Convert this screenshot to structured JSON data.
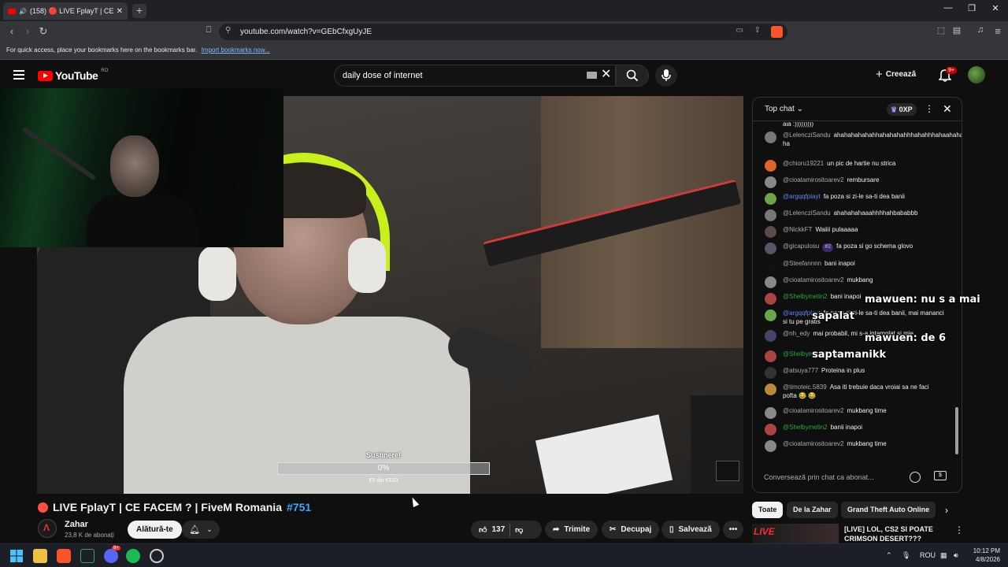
{
  "browser": {
    "tab_title": "(158) 🔴 LIVE FplayT | CE FAC",
    "tab_count_badge": "(158)",
    "url": "youtube.com/watch?v=GEbCfxgUyJE",
    "bookmarks_prompt": "For quick access, place your bookmarks here on the bookmarks bar.",
    "bookmarks_link": "Import bookmarks now..."
  },
  "youtube": {
    "logo_text": "YouTube",
    "country_code": "RO",
    "search_value": "daily dose of internet",
    "create_label": "Creează",
    "notifications_count": "9+"
  },
  "video": {
    "goal_label": "Sustinere!",
    "goal_percent": "0%",
    "goal_amount": "€0 din €100",
    "goal_progress": 0,
    "title_prefix": "LIVE FplayT | CE FACEM ? | FiveM Romania",
    "title_hashtag": "#751",
    "channel_name": "Zahar",
    "subscribers": "23,8 K de abonați",
    "join_label": "Alătură-te",
    "likes": "137",
    "share_label": "Trimite",
    "clip_label": "Decupaj",
    "save_label": "Salvează"
  },
  "chat": {
    "header": "Top chat",
    "xp": "0XP",
    "input_placeholder": "Conversează prin chat ca abonat...",
    "messages": [
      {
        "author": "",
        "text": "aia :)))))))))",
        "color": "#555"
      },
      {
        "author": "@LelencziSandu",
        "text": "ahahahahahahhahahahahhhahahhhahaahahahaha ha",
        "color": "#777"
      },
      {
        "author": "@chioru19221",
        "text": "un pic de hartie nu strica",
        "color": "#e0632c"
      },
      {
        "author": "@cioatamirositoarev2",
        "text": "rembursare",
        "color": "#888"
      },
      {
        "author": "@argqqfplayt",
        "text": "fa poza si zi-le sa-ti dea banii",
        "color": "#6aa54a"
      },
      {
        "author": "@LelencziSandu",
        "text": "ahahahahaaahhhhahbababbb",
        "color": "#777"
      },
      {
        "author": "@NickkFT",
        "text": "Waiiii pulaaaaa",
        "color": "#5a4a4a"
      },
      {
        "author": "@gicapulosu",
        "text": "fa poza si go schema glovo",
        "color": "#556"
      },
      {
        "author": "@Steefannnn",
        "text": "bani inapoi",
        "color": "#111"
      },
      {
        "author": "@cioatamirositoarev2",
        "text": "mukbang",
        "color": "#888"
      },
      {
        "author": "@Shelbymetin2",
        "text": "bani inapoi",
        "color": "#a44"
      },
      {
        "author": "@argqqfplayt",
        "text": "fa poza si zi-le sa-ti dea banii, mai mananci si tu pe gratis",
        "color": "#6aa54a"
      },
      {
        "author": "@nh_edy",
        "text": "mai probabil, mi s-a intamplat si mie",
        "color": "#446"
      },
      {
        "author": "@Shelbymetin2",
        "text": "tambors",
        "color": "#a44"
      },
      {
        "author": "@atsuya777",
        "text": "Proteina in plus",
        "color": "#333"
      },
      {
        "author": "@timoteic.5839",
        "text": "Asa iti trebuie daca vroiai sa ne faci pofta 😂 😂",
        "color": "#b98a3a"
      },
      {
        "author": "@cioatamirositoarev2",
        "text": "mukbang time",
        "color": "#888"
      },
      {
        "author": "@Shelbymetin2",
        "text": "banii inapoi",
        "color": "#a44"
      },
      {
        "author": "@cioatamirositoarev2",
        "text": "mukbang time",
        "color": "#888"
      }
    ],
    "rank_badge": "#2",
    "overlay_line1": "mawuen: nu s a mai",
    "overlay_line2": "sapalat",
    "overlay_line3": "mawuen: de 6",
    "overlay_line4": "saptamanikk"
  },
  "related": {
    "chips": [
      "Toate",
      "De la Zahar",
      "Grand Theft Auto Online"
    ],
    "rec_title": "[LIVE] LOL, CS2 SI POATE CRIMSON DESERT???",
    "rec_live_tag": "LIVE"
  },
  "taskbar": {
    "language": "ROU",
    "time": "10:12 PM",
    "date": "4/8/2026",
    "discord_badge": "9+"
  }
}
